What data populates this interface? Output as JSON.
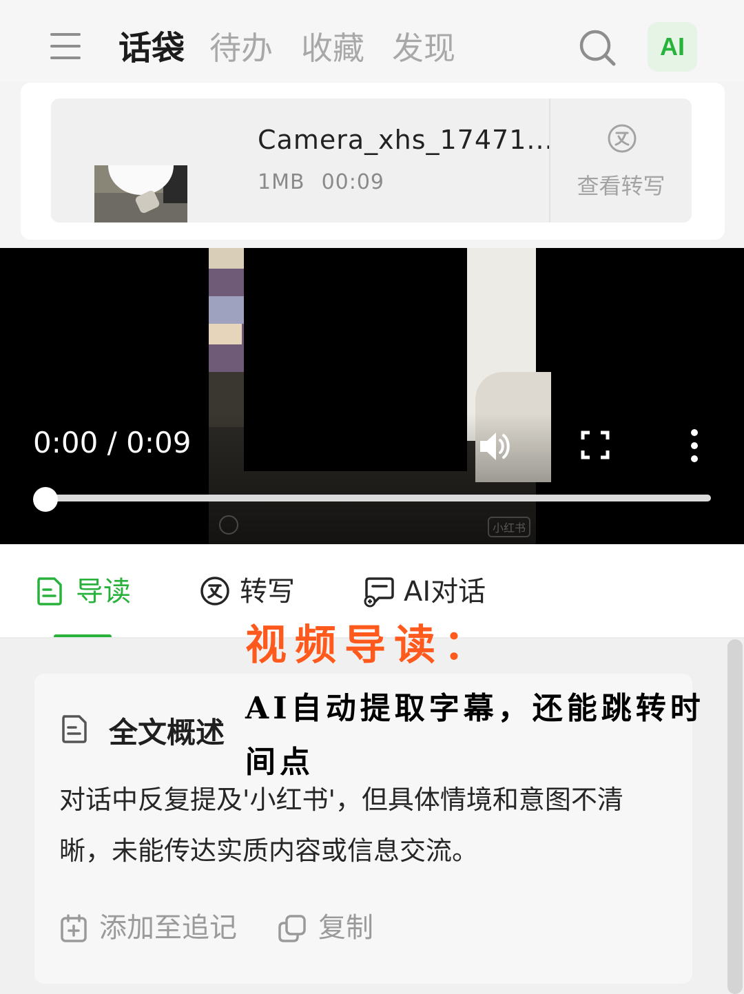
{
  "header": {
    "tabs": [
      {
        "label": "话袋",
        "active": true
      },
      {
        "label": "待办",
        "active": false
      },
      {
        "label": "收藏",
        "active": false
      },
      {
        "label": "发现",
        "active": false
      }
    ],
    "ai_label": "AI",
    "icons": {
      "menu": "hamburger-icon",
      "search": "search-icon"
    }
  },
  "file_card": {
    "name": "Camera_xhs_17471...",
    "size": "1MB",
    "duration": "00:09",
    "view_transcript_label": "查看转写",
    "transcript_icon": "translate-icon"
  },
  "video_player": {
    "time_display": "0:00 / 0:09",
    "current_time": "0:00",
    "total_time": "0:09",
    "progress_fraction": 0,
    "watermark_right": "小红书",
    "icons": {
      "volume": "volume-icon",
      "fullscreen": "fullscreen-icon",
      "more": "more-vert-icon"
    }
  },
  "tabs": [
    {
      "label": "导读",
      "icon": "document-icon",
      "active": true
    },
    {
      "label": "转写",
      "icon": "translate-icon",
      "active": false
    },
    {
      "label": "AI对话",
      "icon": "chat-icon",
      "active": false
    }
  ],
  "summary": {
    "title": "全文概述",
    "text": "对话中反复提及'小红书'，但具体情境和意图不清晰，未能传达实质内容或信息交流。",
    "add_label": "添加至追记",
    "copy_label": "复制"
  },
  "annotation": {
    "title": "视频导读：",
    "body": "AI自动提取字幕，还能跳转时间点"
  },
  "colors": {
    "accent_green": "#28b23b",
    "annotation_orange": "#ff5a1e",
    "video_bg": "#000000"
  }
}
